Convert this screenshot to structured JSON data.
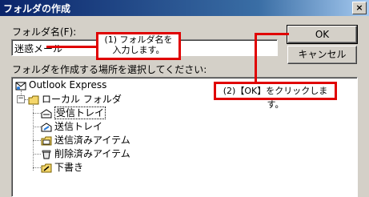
{
  "window": {
    "title": "フォルダの作成",
    "close_glyph": "×"
  },
  "folder_name": {
    "label": "フォルダ名(F):",
    "value": "迷惑メール"
  },
  "location_label": "フォルダを作成する場所を選択してください:",
  "buttons": {
    "ok": "OK",
    "cancel": "キャンセル"
  },
  "callouts": {
    "one_line1": "(1) フォルダ名を",
    "one_line2": "入力します。",
    "two": "(2)【OK】をクリックします。"
  },
  "tree": {
    "root": "Outlook Express",
    "local": "ローカル フォルダ",
    "inbox": "受信トレイ",
    "outbox": "送信トレイ",
    "sent": "送信済みアイテム",
    "deleted": "削除済みアイテム",
    "drafts": "下書き",
    "expander_glyph": "−"
  }
}
